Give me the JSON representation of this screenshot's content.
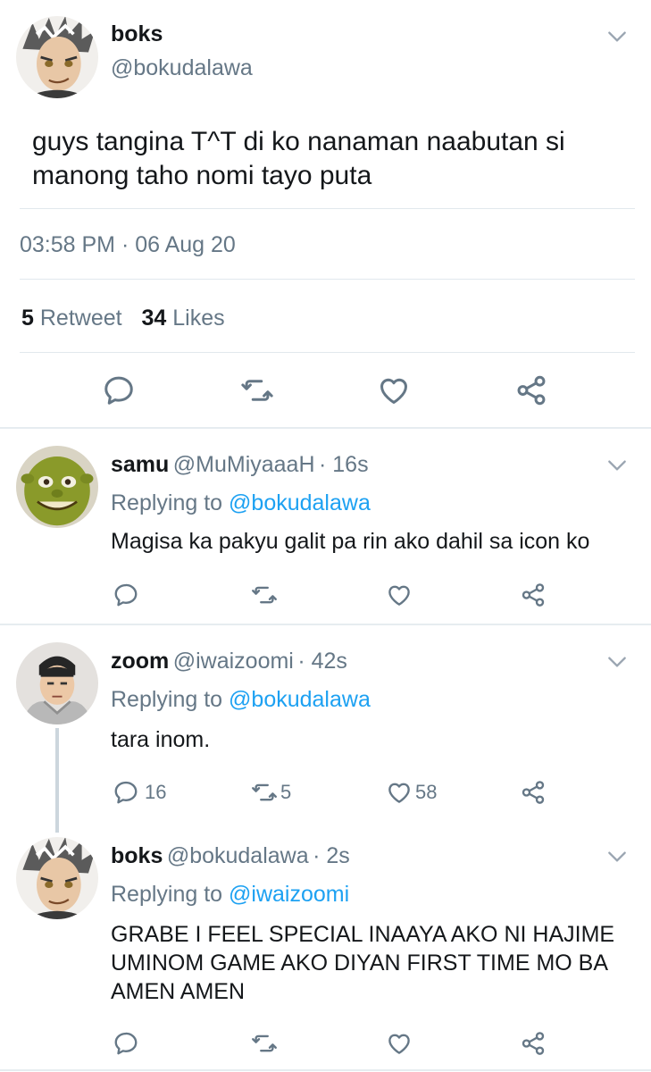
{
  "main_tweet": {
    "name": "boks",
    "handle": "@bokudalawa",
    "text_line1": "guys tangina T^T di ko nanaman naabutan si",
    "text_line2": "manong taho nomi tayo puta",
    "timestamp": "03:58 PM · 06 Aug 20",
    "retweet_count": "5",
    "retweet_label": "Retweet",
    "likes_count": "34",
    "likes_label": "Likes"
  },
  "replies": [
    {
      "name": "samu",
      "handle": "@MuMiyaaaH",
      "time": "· 16s",
      "replying_prefix": "Replying to",
      "replying_to": "@bokudalawa",
      "text": "Magisa ka pakyu galit pa rin ako dahil sa icon ko",
      "reply_count": "",
      "retweet_count": "",
      "like_count": ""
    },
    {
      "name": "zoom",
      "handle": "@iwaizoomi",
      "time": "· 42s",
      "replying_prefix": "Replying to",
      "replying_to": "@bokudalawa",
      "text": "tara inom.",
      "reply_count": "16",
      "retweet_count": "5",
      "like_count": "58"
    },
    {
      "name": "boks",
      "handle": "@bokudalawa",
      "time": "· 2s",
      "replying_prefix": "Replying to",
      "replying_to": "@iwaizoomi",
      "text_line1": "GRABE I FEEL SPECIAL INAAYA AKO NI HAJIME",
      "text_line2": "UMINOM GAME AKO DIYAN FIRST TIME MO BA",
      "text_line3": "AMEN AMEN",
      "reply_count": "",
      "retweet_count": "",
      "like_count": ""
    }
  ],
  "icons": {
    "reply": "reply-icon",
    "retweet": "retweet-icon",
    "like": "heart-icon",
    "share": "share-icon",
    "more": "chevron-down-icon"
  },
  "colors": {
    "link": "#1da1f2",
    "muted": "#657786",
    "text": "#14171a"
  }
}
